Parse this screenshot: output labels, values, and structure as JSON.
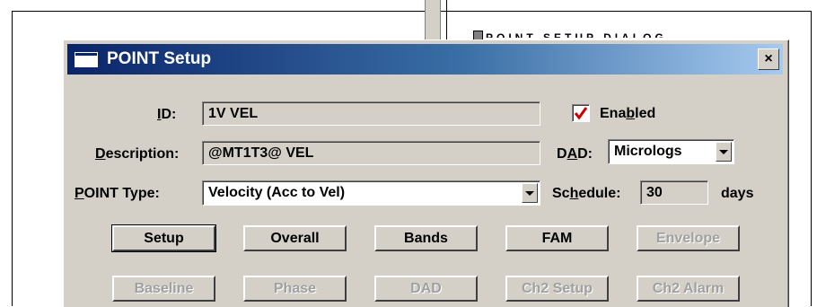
{
  "background_tree": {
    "item_label": "POINT SETUP DIALOG"
  },
  "dialog": {
    "title": "POINT Setup",
    "close_label": "×",
    "id_label": {
      "u": "I",
      "rest": "D:"
    },
    "id_value": "1V VEL",
    "enabled_label": {
      "pre": "Ena",
      "u": "b",
      "rest": "led"
    },
    "enabled_checked": true,
    "description_label": {
      "u": "D",
      "rest": "escription:"
    },
    "description_value": "@MT1T3@ VEL",
    "dad_label": {
      "pre": "D",
      "u": "A",
      "rest": "D:"
    },
    "dad_value": "Micrologs",
    "point_type_label": {
      "u": "P",
      "rest": "OINT Type:"
    },
    "point_type_value": "Velocity (Acc to Vel)",
    "schedule_label": {
      "pre": "Sc",
      "u": "h",
      "rest": "edule:"
    },
    "schedule_value": "30",
    "schedule_unit": "days",
    "buttons_row1": [
      {
        "label": "Setup",
        "enabled": true,
        "default": true
      },
      {
        "label": "Overall",
        "enabled": true
      },
      {
        "label": "Bands",
        "enabled": true
      },
      {
        "label": "FAM",
        "enabled": true
      },
      {
        "label": "Envelope",
        "enabled": false
      }
    ],
    "buttons_row2": [
      {
        "label": "Baseline",
        "enabled": false
      },
      {
        "label": "Phase",
        "enabled": false
      },
      {
        "label": "DAD",
        "enabled": false
      },
      {
        "label": "Ch2 Setup",
        "enabled": false
      },
      {
        "label": "Ch2 Alarm",
        "enabled": false
      }
    ]
  },
  "colors": {
    "title_gradient_start": "#0a246a",
    "title_gradient_end": "#a6caf0",
    "dialog_face": "#d4d0c8",
    "check_mark": "#cc0000"
  }
}
